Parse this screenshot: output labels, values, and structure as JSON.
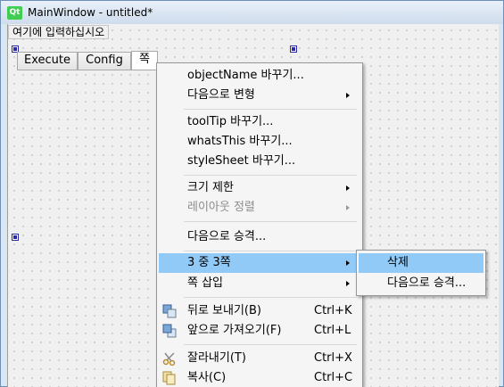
{
  "window": {
    "logo_text": "Qt",
    "title": "MainWindow - untitled*"
  },
  "menubar": {
    "placeholder_item": "여기에 입력하십시오"
  },
  "tabs": [
    {
      "label": "Execute"
    },
    {
      "label": "Config"
    },
    {
      "label": "쪽"
    }
  ],
  "context_menu": {
    "items": [
      {
        "label": "objectName 바꾸기..."
      },
      {
        "label": "다음으로 변형",
        "submenu": true
      },
      {
        "label": "toolTip 바꾸기..."
      },
      {
        "label": "whatsThis 바꾸기..."
      },
      {
        "label": "styleSheet 바꾸기..."
      },
      {
        "label": "크기 제한",
        "submenu": true
      },
      {
        "label": "레이아웃 정렬",
        "submenu": true,
        "disabled": true
      },
      {
        "label": "다음으로 승격..."
      },
      {
        "label": "3 중 3쪽",
        "submenu": true,
        "highlighted": true
      },
      {
        "label": "쪽 삽입",
        "submenu": true
      },
      {
        "label": "뒤로 보내기(B)",
        "shortcut": "Ctrl+K",
        "icon": "send-to-back-icon"
      },
      {
        "label": "앞으로 가져오기(F)",
        "shortcut": "Ctrl+L",
        "icon": "bring-to-front-icon"
      },
      {
        "label": "잘라내기(T)",
        "shortcut": "Ctrl+X",
        "icon": "scissors-icon"
      },
      {
        "label": "복사(C)",
        "shortcut": "Ctrl+C",
        "icon": "copy-icon"
      }
    ]
  },
  "submenu": {
    "items": [
      {
        "label": "삭제",
        "highlighted": true
      },
      {
        "label": "다음으로 승격..."
      }
    ]
  },
  "colors": {
    "highlight": "#91c9f7",
    "handle": "#2a2aa8",
    "qt_green": "#41cd52"
  }
}
